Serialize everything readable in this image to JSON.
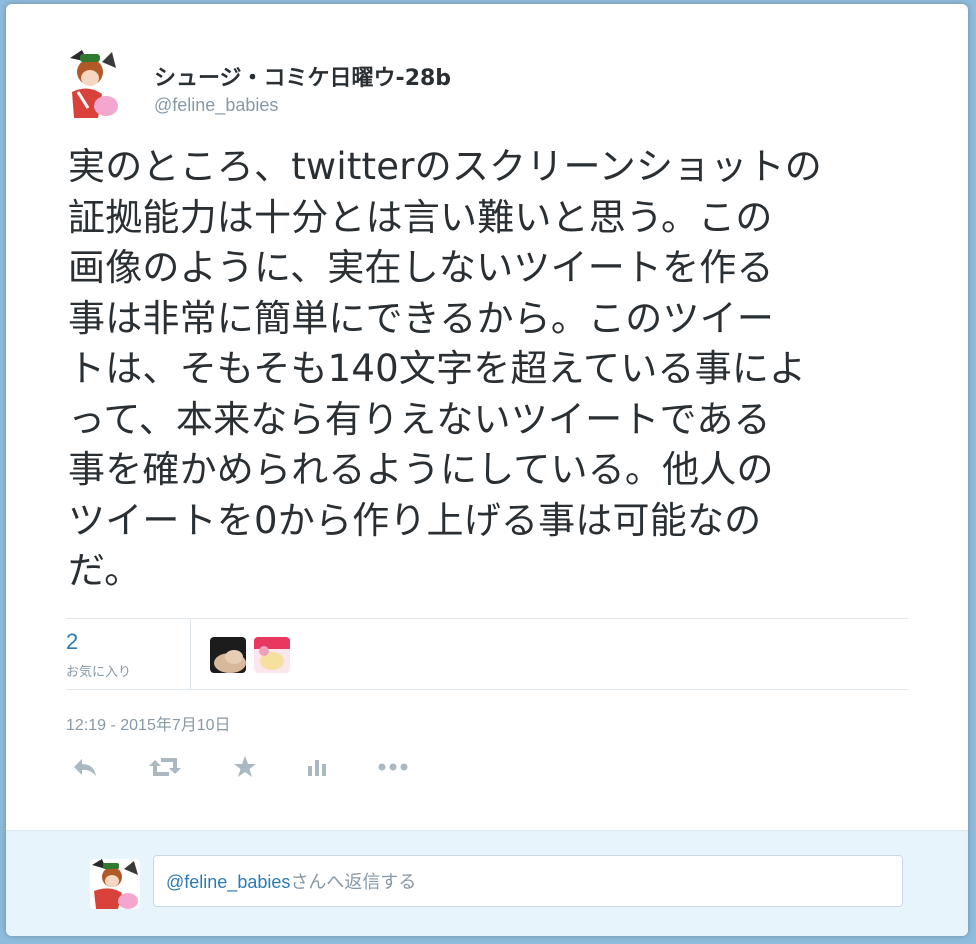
{
  "tweet": {
    "display_name": "シュージ・コミケ日曜ウ-28b",
    "handle": "@feline_babies",
    "text_lines": [
      "実のところ、twitterのスクリーンショットの",
      "証拠能力は十分とは言い難いと思う。この",
      "画像のように、実在しないツイートを作る",
      "事は非常に簡単にできるから。このツイー",
      "トは、そもそも140文字を超えている事によ",
      "って、本来なら有りえないツイートである",
      "事を確かめられるようにしている。他人の",
      "ツイートを0から作り上げる事は可能なの",
      "だ。"
    ],
    "favorites_count": "2",
    "favorites_label": "お気に入り",
    "timestamp": "12:19 - 2015年7月10日"
  },
  "actions": {
    "reply_icon": "reply-icon",
    "retweet_icon": "retweet-icon",
    "favorite_icon": "star-icon",
    "analytics_icon": "analytics-icon",
    "more_icon": "more-icon"
  },
  "reply_box": {
    "mention": "@feline_babies",
    "placeholder_suffix": "さんへ返信する"
  },
  "colors": {
    "background": "#8fbcdc",
    "text": "#292f33",
    "muted": "#8899a6",
    "link": "#2b7bb9",
    "reply_area": "#e8f4fb"
  }
}
